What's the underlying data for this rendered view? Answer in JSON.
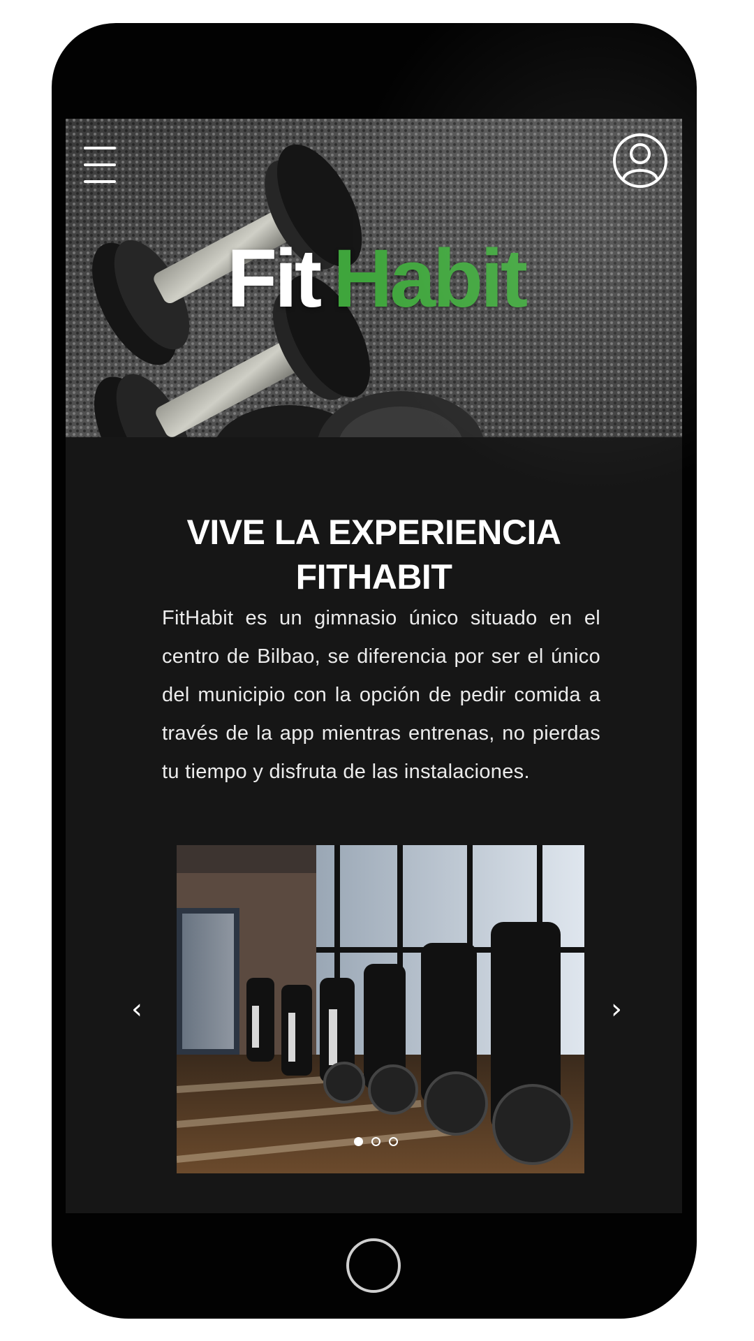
{
  "header": {
    "menu_icon": "hamburger-menu-icon",
    "user_icon": "user-account-icon",
    "logo": {
      "part1": "Fit",
      "part2": "Habit",
      "part1_color": "#ffffff",
      "part2_color": "#3fa53c"
    }
  },
  "hero": {
    "image": "dumbbells-on-rubber-floor"
  },
  "intro": {
    "title_line1": "VIVE LA EXPERIENCIA",
    "title_line2": "FITHABIT",
    "body": "FitHabit es un gimnasio único situado en el centro de Bilbao, se diferencia por ser el único del municipio con la opción de pedir comida a través de la app mientras entrenas, no pierdas tu tiempo y disfruta de las instalaciones."
  },
  "carousel": {
    "prev_label": "‹",
    "next_label": "›",
    "image": "spinning-bikes-room",
    "slide_count": 3,
    "active_index": 0
  },
  "device": {
    "home_button_icon": "home-button-icon"
  }
}
